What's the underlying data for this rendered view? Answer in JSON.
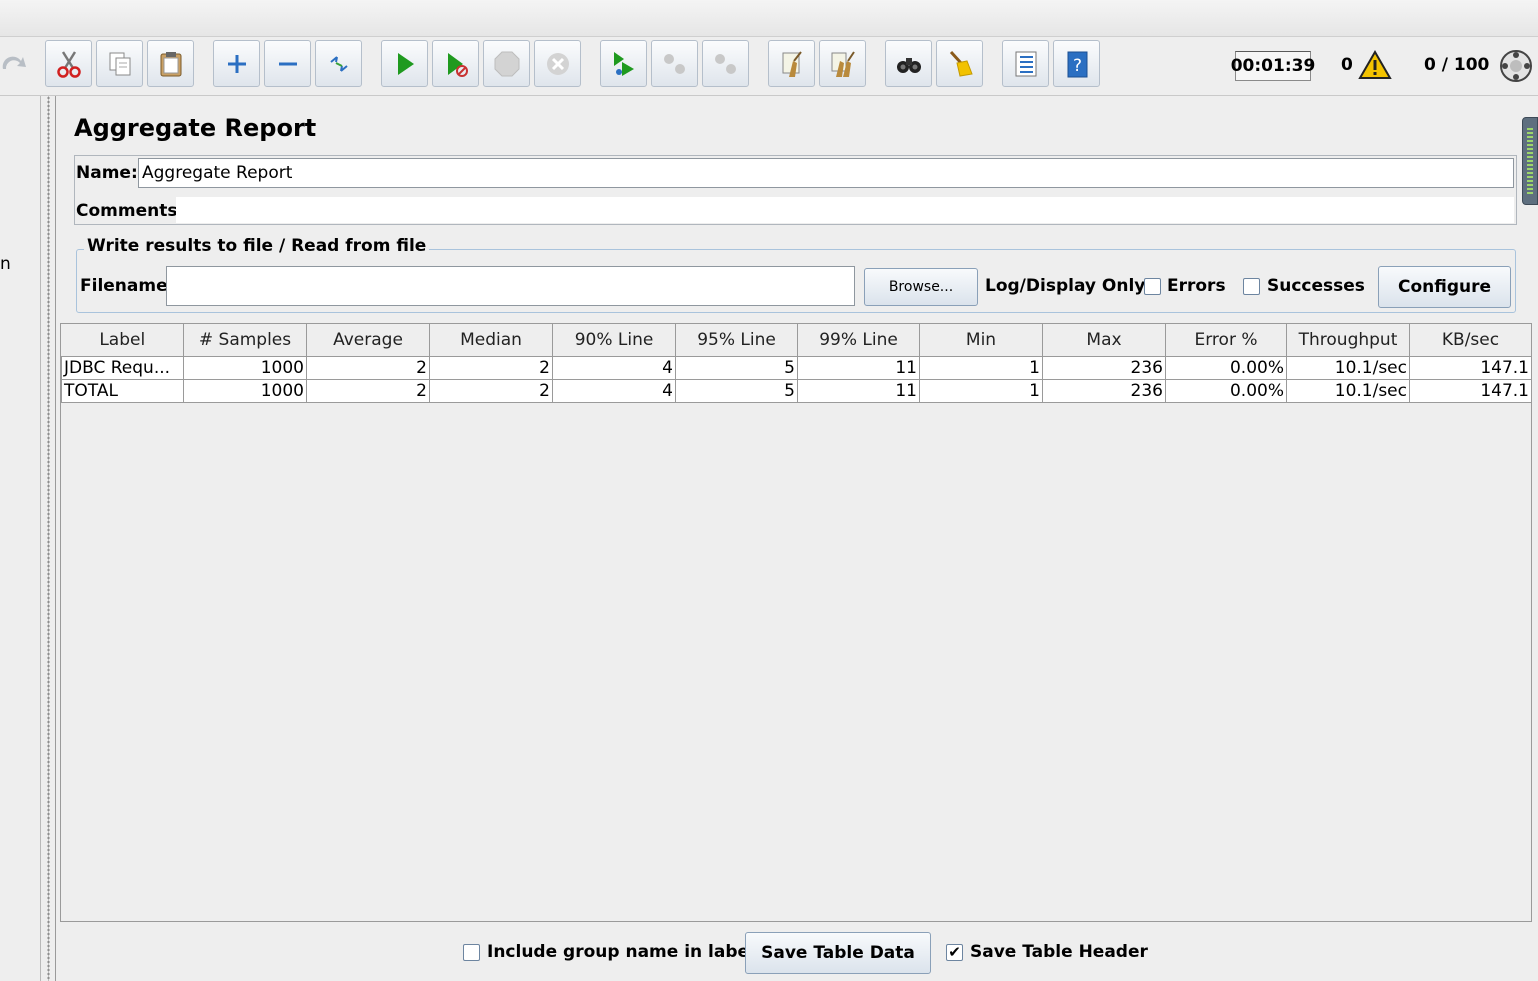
{
  "toolbar": {
    "buttons": [
      {
        "name": "redo-icon"
      },
      {
        "name": "cut-icon"
      },
      {
        "name": "copy-icon"
      },
      {
        "name": "paste-icon"
      },
      {
        "name": "expand-icon"
      },
      {
        "name": "collapse-icon"
      },
      {
        "name": "toggle-icon"
      },
      {
        "name": "start-icon"
      },
      {
        "name": "start-no-pauses-icon"
      },
      {
        "name": "stop-icon"
      },
      {
        "name": "shutdown-icon"
      },
      {
        "name": "remote-start-icon"
      },
      {
        "name": "remote-stop-icon"
      },
      {
        "name": "remote-shutdown-icon"
      },
      {
        "name": "clear-icon"
      },
      {
        "name": "clear-all-icon"
      },
      {
        "name": "search-icon"
      },
      {
        "name": "reset-search-icon"
      },
      {
        "name": "function-helper-icon"
      },
      {
        "name": "help-icon"
      }
    ],
    "timer": "00:01:39",
    "warning_count": "0",
    "threads": "0 / 100"
  },
  "left_tree": {
    "visible_fragment": "n"
  },
  "panel": {
    "title": "Aggregate Report",
    "name_label": "Name:",
    "name_value": "Aggregate Report",
    "comments_label": "Comments:",
    "file_section": {
      "legend": "Write results to file / Read from file",
      "filename_label": "Filename",
      "filename_value": "",
      "browse_label": "Browse...",
      "log_display_label": "Log/Display Only:",
      "errors_label": "Errors",
      "errors_checked": false,
      "successes_label": "Successes",
      "successes_checked": false,
      "configure_label": "Configure"
    }
  },
  "table": {
    "columns": [
      "Label",
      "# Samples",
      "Average",
      "Median",
      "90% Line",
      "95% Line",
      "99% Line",
      "Min",
      "Max",
      "Error %",
      "Throughput",
      "KB/sec"
    ],
    "rows": [
      [
        "JDBC Requ...",
        "1000",
        "2",
        "2",
        "4",
        "5",
        "11",
        "1",
        "236",
        "0.00%",
        "10.1/sec",
        "147.1"
      ],
      [
        "TOTAL",
        "1000",
        "2",
        "2",
        "4",
        "5",
        "11",
        "1",
        "236",
        "0.00%",
        "10.1/sec",
        "147.1"
      ]
    ]
  },
  "footer": {
    "include_group_label": "Include group name in label?",
    "include_group_checked": false,
    "save_table_data_label": "Save Table Data",
    "save_table_header_label": "Save Table Header",
    "save_table_header_checked": true
  },
  "colors": {
    "accent_blue": "#2b6fc2",
    "play_green": "#1f9a1f",
    "warning_yellow": "#f2c200"
  }
}
